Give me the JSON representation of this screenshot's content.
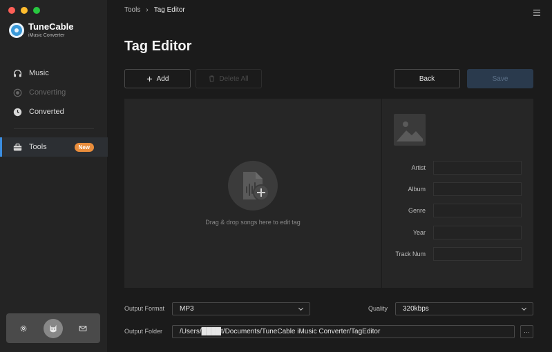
{
  "window": {
    "traffic_colors": [
      "#fe5f57",
      "#febc2e",
      "#28c840"
    ]
  },
  "brand": {
    "name": "TuneCable",
    "subtitle": "iMusic Converter"
  },
  "sidebar": {
    "items": [
      {
        "label": "Music",
        "icon": "headphones-icon"
      },
      {
        "label": "Converting",
        "icon": "converting-icon"
      },
      {
        "label": "Converted",
        "icon": "clock-icon"
      },
      {
        "label": "Tools",
        "icon": "toolbox-icon",
        "badge": "New"
      }
    ],
    "bottom": {
      "settings_icon": "gear-icon",
      "avatar_icon": "avatar-icon",
      "mail_icon": "mail-icon"
    }
  },
  "breadcrumb": {
    "parent": "Tools",
    "separator": "›",
    "current": "Tag Editor"
  },
  "page": {
    "title": "Tag Editor"
  },
  "toolbar": {
    "add_label": "Add",
    "delete_all_label": "Delete All",
    "back_label": "Back",
    "save_label": "Save"
  },
  "drop": {
    "text": "Drag & drop songs here to edit tag"
  },
  "tags": {
    "fields": [
      {
        "label": "Artist",
        "value": ""
      },
      {
        "label": "Album",
        "value": ""
      },
      {
        "label": "Genre",
        "value": ""
      },
      {
        "label": "Year",
        "value": ""
      },
      {
        "label": "Track Num",
        "value": ""
      }
    ]
  },
  "output": {
    "format_label": "Output Format",
    "format_value": "MP3",
    "quality_label": "Quality",
    "quality_value": "320kbps",
    "folder_label": "Output Folder",
    "folder_value": "/Users/████t/Documents/TuneCable iMusic Converter/TagEditor",
    "browse_label": "···"
  },
  "colors": {
    "accent": "#3b8de0",
    "badge": "#e98d3c",
    "save_disabled": "#2a3a4d"
  }
}
